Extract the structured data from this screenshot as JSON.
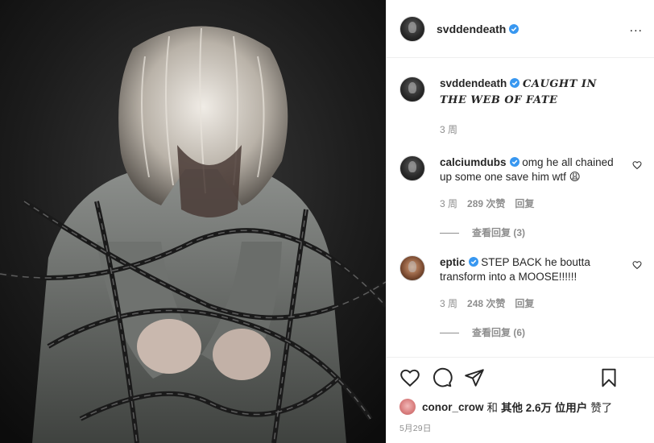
{
  "author": {
    "username": "svddendeath",
    "verified": true,
    "avatar_icon": "avatar-icon"
  },
  "more_options": "...",
  "caption": {
    "username": "svddendeath",
    "text": "CAUGHT IN THE WEB OF FATE",
    "time": "3 周"
  },
  "comments": [
    {
      "username": "calciumdubs",
      "verified": true,
      "text": "omg he all chained up some one save him wtf 😩",
      "time": "3 周",
      "likes": "289 次赞",
      "reply_label": "回复",
      "view_replies": "查看回复 (3)"
    },
    {
      "username": "eptic",
      "verified": true,
      "text": "STEP BACK he boutta transform into a MOOSE!!!!!!",
      "time": "3 周",
      "likes": "248 次赞",
      "reply_label": "回复",
      "view_replies": "查看回复 (6)"
    }
  ],
  "likes_summary": {
    "user": "conor_crow",
    "and": "和",
    "others": "其他 2.6万 位用户",
    "liked": "赞了"
  },
  "date": "5月29日",
  "colors": {
    "verified": "#3897f0",
    "text": "#262626",
    "muted": "#8e8e8e",
    "border": "#efefef"
  }
}
